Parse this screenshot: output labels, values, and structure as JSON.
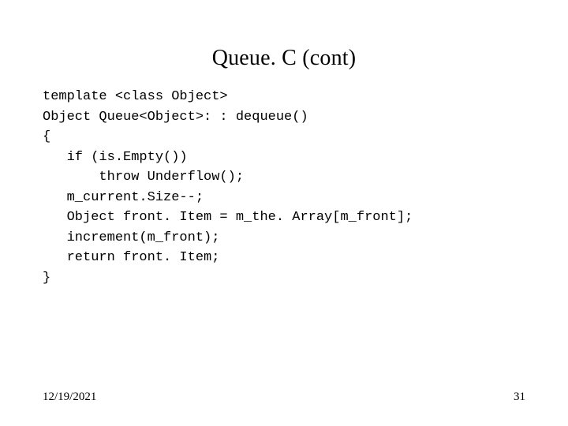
{
  "title": "Queue. C (cont)",
  "code": {
    "l1": "template <class Object>",
    "l2": "Object Queue<Object>: : dequeue()",
    "l3": "{",
    "l4": "   if (is.Empty())",
    "l5": "       throw Underflow();",
    "l6": "   m_current.Size--;",
    "l7": "   Object front. Item = m_the. Array[m_front];",
    "l8": "   increment(m_front);",
    "l9": "   return front. Item;",
    "l10": "}"
  },
  "footer": {
    "date": "12/19/2021",
    "page": "31"
  }
}
